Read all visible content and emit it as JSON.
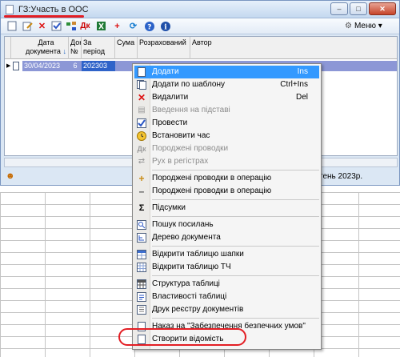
{
  "window": {
    "title": "ГЗ:Участь в ООС",
    "btn_min": "–",
    "btn_max": "□",
    "btn_close": "✕",
    "menu_label": "Меню"
  },
  "toolbar": {
    "icons": [
      "new-icon",
      "edit-icon",
      "delete-icon",
      "post-icon",
      "structure-icon",
      "dk-icon",
      "excel-icon",
      "add-red-icon",
      "refresh-icon",
      "help-icon",
      "info-icon"
    ],
    "menu_icon": "gear-icon"
  },
  "table": {
    "columns": [
      "",
      "Дата документа",
      "Док №",
      "За період",
      "Сума",
      "Розрахований",
      "Автор"
    ],
    "rows": [
      {
        "marker": "▶",
        "date": "30/04/2023",
        "doc_no": "6",
        "period": "202303",
        "sum": "",
        "calculated": "",
        "author": ""
      }
    ]
  },
  "status": {
    "text": "тень 2023р."
  },
  "context_menu": {
    "items": [
      {
        "label": "Додати",
        "shortcut": "Ins",
        "icon": "page-icon",
        "state": "highlighted"
      },
      {
        "label": "Додати по шаблону",
        "shortcut": "Ctrl+Ins",
        "icon": "page-copy-icon",
        "state": "normal"
      },
      {
        "label": "Видалити",
        "shortcut": "Del",
        "icon": "delete-x-icon",
        "state": "normal"
      },
      {
        "label": "Введення на підставі",
        "shortcut": "",
        "icon": "based-on-icon",
        "state": "disabled"
      },
      {
        "label": "Провести",
        "shortcut": "",
        "icon": "post-check-icon",
        "state": "normal"
      },
      {
        "label": "Встановити час",
        "shortcut": "",
        "icon": "clock-icon",
        "state": "normal"
      },
      {
        "label": "Породжені проводки",
        "shortcut": "",
        "icon": "dk-icon",
        "state": "disabled"
      },
      {
        "label": "Рух в регістрах",
        "shortcut": "",
        "icon": "registers-icon",
        "state": "disabled"
      },
      {
        "label": "Породжені проводки в операцію",
        "shortcut": "",
        "icon": "plus-icon",
        "state": "normal"
      },
      {
        "label": "Породжені проводки в операцію",
        "shortcut": "",
        "icon": "minus-icon",
        "state": "normal"
      },
      {
        "label": "Підсумки",
        "shortcut": "",
        "icon": "sigma-icon",
        "state": "normal"
      },
      {
        "label": "Пошук посилань",
        "shortcut": "",
        "icon": "search-links-icon",
        "state": "normal"
      },
      {
        "label": "Дерево документа",
        "shortcut": "",
        "icon": "tree-icon",
        "state": "normal"
      },
      {
        "label": "Відкрити таблицю шапки",
        "shortcut": "",
        "icon": "header-table-icon",
        "state": "normal"
      },
      {
        "label": "Відкрити таблицю ТЧ",
        "shortcut": "",
        "icon": "tabular-table-icon",
        "state": "normal"
      },
      {
        "label": "Структура таблиці",
        "shortcut": "",
        "icon": "table-structure-icon",
        "state": "normal"
      },
      {
        "label": "Властивості таблиці",
        "shortcut": "",
        "icon": "table-properties-icon",
        "state": "normal"
      },
      {
        "label": "Друк реєстру документів",
        "shortcut": "",
        "icon": "print-icon",
        "state": "normal"
      },
      {
        "label": "Наказ на \"Забезпечення безпечних умов\"",
        "shortcut": "",
        "icon": "order-icon",
        "state": "normal"
      },
      {
        "label": "Створити відомість",
        "shortcut": "",
        "icon": "page-icon",
        "state": "normal"
      }
    ]
  },
  "colors": {
    "highlight": "#3399ff",
    "selected_row": "#8c97d6",
    "annotation_red": "#e31e24"
  }
}
